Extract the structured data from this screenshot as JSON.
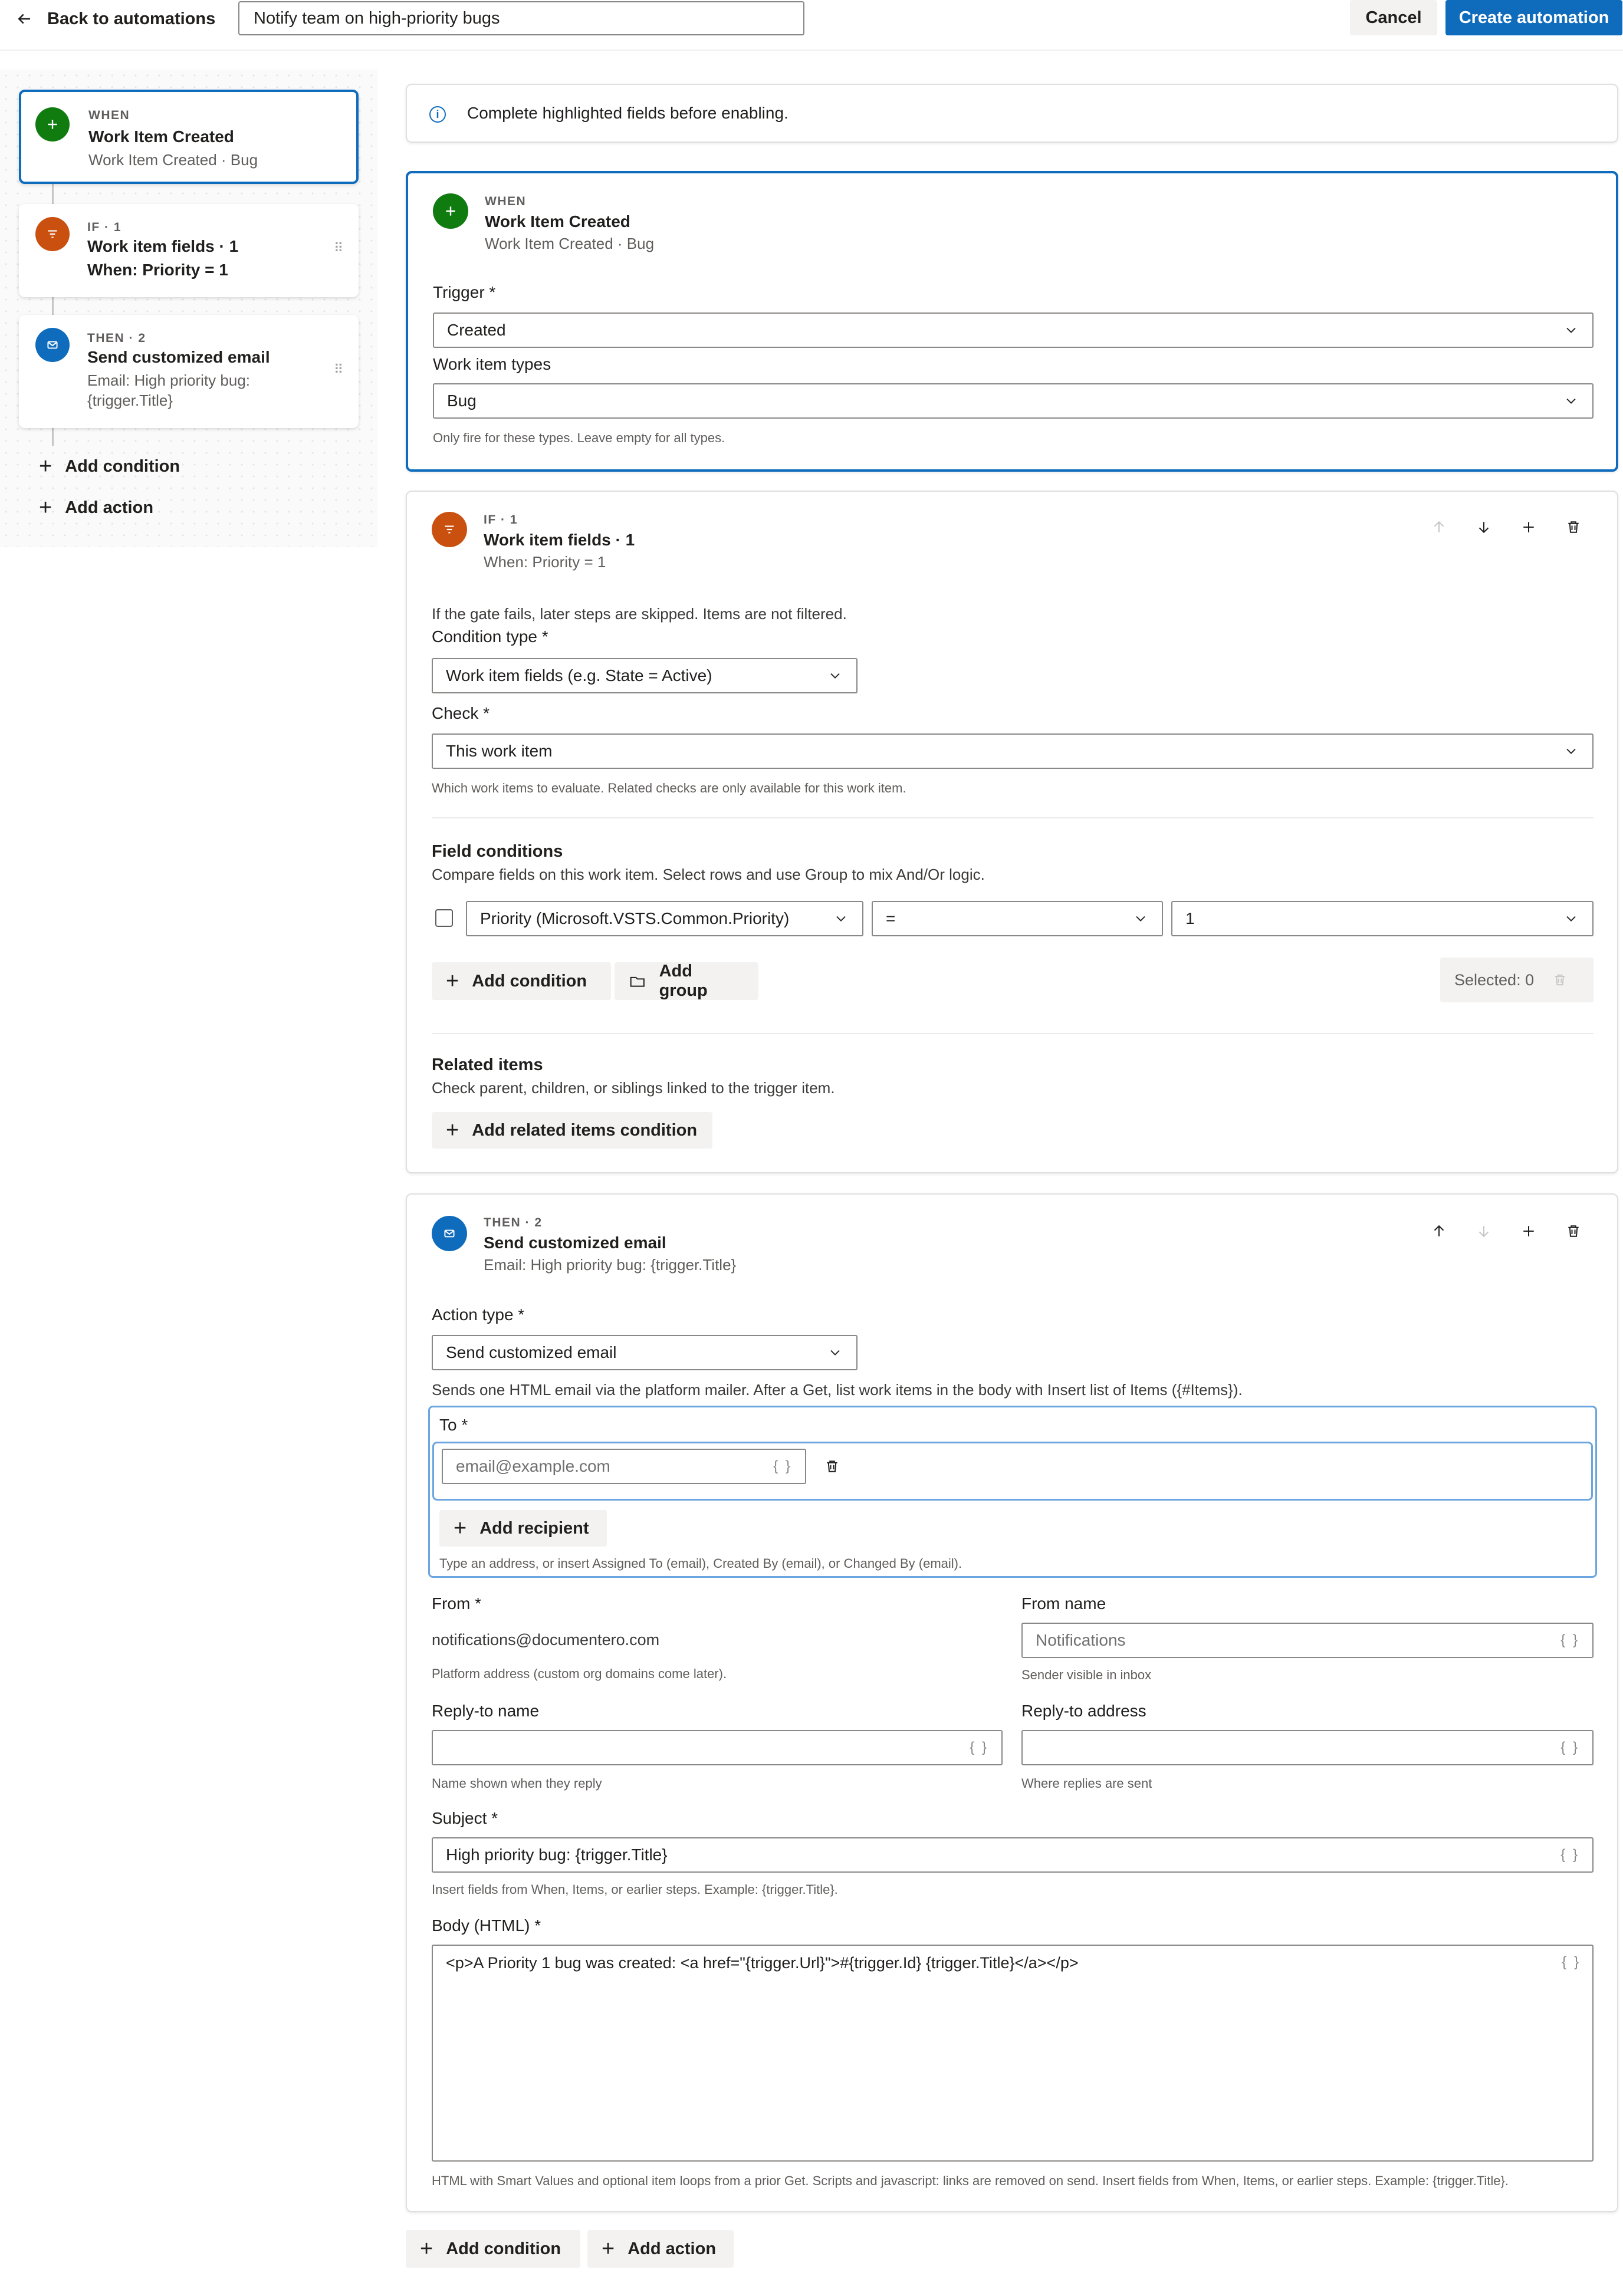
{
  "header": {
    "back_label": "Back to automations",
    "automation_name": "Notify team on high-priority bugs",
    "cancel_label": "Cancel",
    "create_label": "Create automation"
  },
  "sidebar": {
    "when": {
      "eyebrow": "WHEN",
      "title": "Work Item Created",
      "subtitle": "Work Item Created · Bug"
    },
    "if": {
      "eyebrow": "IF · 1",
      "title": "Work item fields · 1",
      "subtitle": "When: Priority = 1"
    },
    "then": {
      "eyebrow": "THEN · 2",
      "title": "Send customized email",
      "subtitle_line1": "Email: High priority bug:",
      "subtitle_line2": "{trigger.Title}"
    },
    "add_condition": "Add condition",
    "add_action": "Add action"
  },
  "notice": {
    "text": "Complete highlighted fields before enabling."
  },
  "when_panel": {
    "eyebrow": "WHEN",
    "title": "Work Item Created",
    "subtitle": "Work Item Created · Bug",
    "trigger_label": "Trigger *",
    "trigger_value": "Created",
    "types_label": "Work item types",
    "types_value": "Bug",
    "types_hint": "Only fire for these types. Leave empty for all types."
  },
  "if_panel": {
    "eyebrow": "IF · 1",
    "title": "Work item fields · 1",
    "subtitle": "When: Priority = 1",
    "gate_note": "If the gate fails, later steps are skipped. Items are not filtered.",
    "condition_type_label": "Condition type *",
    "condition_type_value": "Work item fields (e.g. State = Active)",
    "check_label": "Check *",
    "check_value": "This work item",
    "check_hint": "Which work items to evaluate. Related checks are only available for this work item.",
    "field_conditions_title": "Field conditions",
    "field_conditions_desc": "Compare fields on this work item. Select rows and use Group to mix And/Or logic.",
    "row": {
      "field": "Priority (Microsoft.VSTS.Common.Priority)",
      "operator": "=",
      "value": "1"
    },
    "add_condition": "Add condition",
    "add_group": "Add group",
    "selected": "Selected: 0",
    "related_title": "Related items",
    "related_desc": "Check parent, children, or siblings linked to the trigger item.",
    "add_related": "Add related items condition"
  },
  "then_panel": {
    "eyebrow": "THEN · 2",
    "title": "Send customized email",
    "subtitle": "Email: High priority bug: {trigger.Title}",
    "action_type_label": "Action type *",
    "action_type_value": "Send customized email",
    "action_hint": "Sends one HTML email via the platform mailer. After a Get, list work items in the body with Insert list of Items ({#Items}).",
    "to_label": "To *",
    "to_placeholder": "email@example.com",
    "add_recipient": "Add recipient",
    "to_hint": "Type an address, or insert Assigned To (email), Created By (email), or Changed By (email).",
    "from_label": "From *",
    "from_value": "notifications@documentero.com",
    "from_hint": "Platform address (custom org domains come later).",
    "from_name_label": "From name",
    "from_name_placeholder": "Notifications",
    "from_name_hint": "Sender visible in inbox",
    "reply_name_label": "Reply-to name",
    "reply_name_hint": "Name shown when they reply",
    "reply_addr_label": "Reply-to address",
    "reply_addr_hint": "Where replies are sent",
    "subject_label": "Subject *",
    "subject_value": "High priority bug: {trigger.Title}",
    "subject_hint": "Insert fields from When, Items, or earlier steps. Example: {trigger.Title}.",
    "body_label": "Body (HTML) *",
    "body_value": "<p>A Priority 1 bug was created: <a href=\"{trigger.Url}\">#{trigger.Id} {trigger.Title}</a></p>",
    "body_hint": "HTML with Smart Values and optional item loops from a prior Get. Scripts and javascript: links are removed on send. Insert fields from When, Items, or earlier steps. Example: {trigger.Title}."
  },
  "footer": {
    "add_condition": "Add condition",
    "add_action": "Add action"
  },
  "brace_glyph": "{ }",
  "colors": {
    "accent": "#0f6cbd",
    "when": "#107c10",
    "if": "#ca5010",
    "then": "#0f6cbd"
  }
}
